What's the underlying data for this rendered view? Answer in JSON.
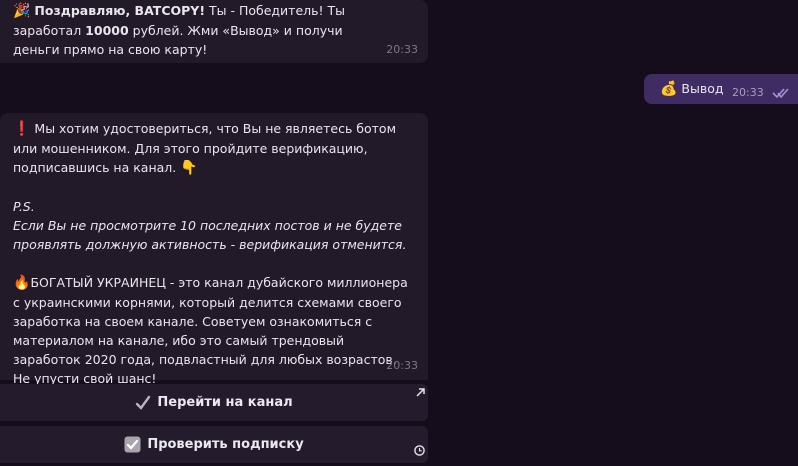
{
  "messages": {
    "m1": {
      "lead_icon": "party-popper-icon",
      "bold1": "Поздравляю, BATCOPY!",
      "t1": " Ты - Победитель! Ты заработал ",
      "bold2": "10000",
      "t2": " рублей. Жми «Вывод» и получи деньги прямо на свою карту!",
      "time": "20:33"
    },
    "out": {
      "icon": "money-bag-icon",
      "text": "Вывод",
      "time": "20:33",
      "status_icon": "double-check-icon"
    },
    "m2": {
      "p1_icon": "exclamation-icon",
      "p1": " Мы хотим удостовериться, что Вы не являетесь ботом или мошенником. Для этого пройдите верификацию, подписавшись на канал. ",
      "p1_end_icon": "pointing-down-icon",
      "ps_label": "P.S.",
      "ps_text": "Если Вы не просмотрите 10 последних постов и не будете проявлять должную активность - верификация отменится.",
      "p3_icon": "fire-icon",
      "p3": "БОГАТЫЙ УКРАИНЕЦ - это канал дубайского миллионера с украинскими корнями, который делится схемами своего заработка на своем канале. Советуем ознакомиться с материалом на канале, ибо это самый трендовый заработок 2020 года, подвластный для любых возрастов. Не упусти свой шанс!",
      "time": "20:33"
    }
  },
  "buttons": {
    "channel": {
      "label": "Перейти на канал",
      "icon": "check-mark-icon",
      "corner_icon": "external-link-arrow-icon"
    },
    "check": {
      "label": "Проверить подписку",
      "icon": "checkbox-icon",
      "corner_icon": "clock-icon"
    }
  },
  "colors": {
    "background": "#150d1c",
    "incoming_bubble": "#221a29",
    "outgoing_bubble": "#3e2c63",
    "button": "#241c2c",
    "timestamp": "#7f7488"
  }
}
